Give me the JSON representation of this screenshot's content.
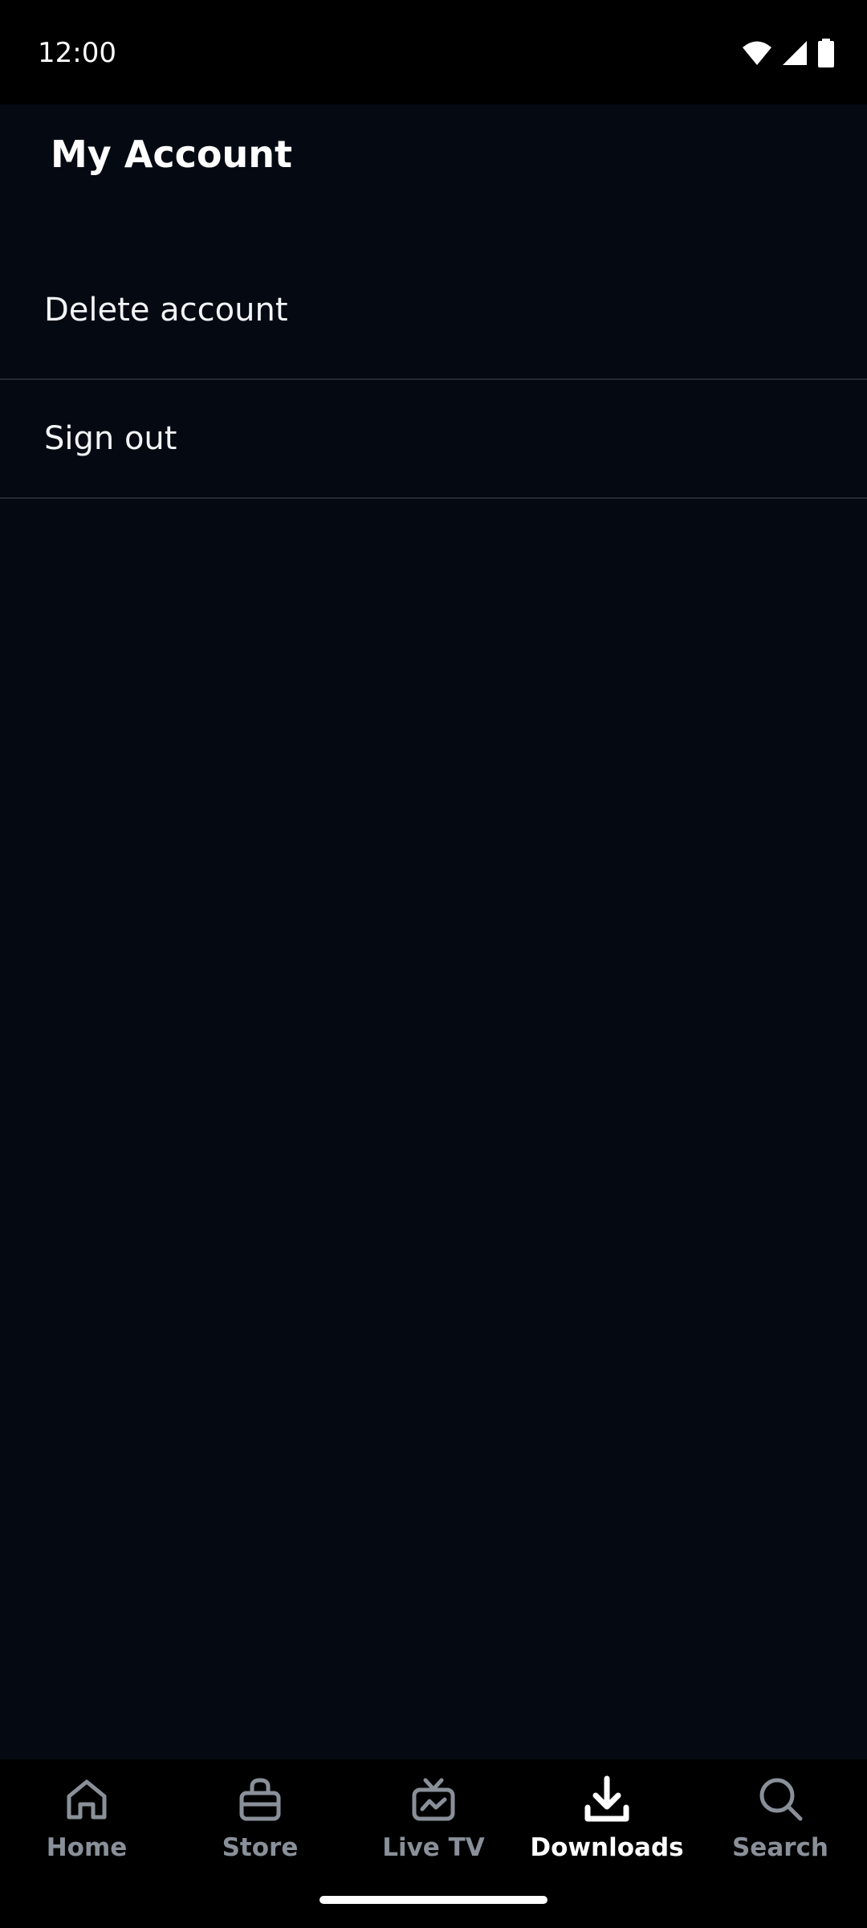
{
  "status_bar": {
    "time": "12:00",
    "icons": [
      "wifi-icon",
      "cellular-signal-icon",
      "battery-icon"
    ]
  },
  "page": {
    "title": "My Account"
  },
  "menu": {
    "items": [
      {
        "label": "Delete account"
      },
      {
        "label": "Sign out"
      }
    ]
  },
  "bottom_nav": {
    "active": "Downloads",
    "items": [
      {
        "label": "Home",
        "icon": "home-icon"
      },
      {
        "label": "Store",
        "icon": "shopping-bag-icon"
      },
      {
        "label": "Live TV",
        "icon": "live-tv-icon"
      },
      {
        "label": "Downloads",
        "icon": "download-icon"
      },
      {
        "label": "Search",
        "icon": "search-icon"
      }
    ]
  },
  "colors": {
    "background": "#050a12",
    "status_bar": "#000000",
    "nav_inactive": "#8a9099",
    "nav_active": "#ffffff",
    "divider": "#262b33"
  }
}
